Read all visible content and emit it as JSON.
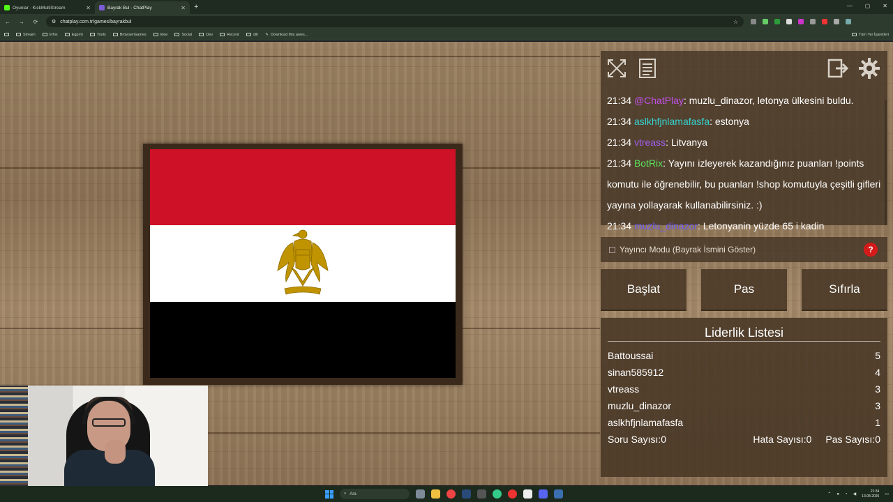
{
  "browser": {
    "tabs": [
      {
        "label": "Oyunlar - KickMultiStream",
        "active": false
      },
      {
        "label": "Bayrak Bul - ChatPlay",
        "active": true
      }
    ],
    "url": "chatplay.com.tr/games/bayrakbul",
    "bookmarks": [
      "Stream",
      "Infox",
      "Egprnt",
      "Tools",
      "BrowserGames",
      "Idee",
      "Social",
      "Dev",
      "Recent",
      "oth",
      "Download this awes..."
    ],
    "bookmarks_right": "Tüm Yer İşaretleri",
    "window_controls": [
      "—",
      "▢",
      "✕"
    ]
  },
  "game": {
    "flag_colors": [
      "#ce1126",
      "#ffffff",
      "#000000"
    ],
    "flag_emblem": "eagle-of-saladin-icon",
    "panel_icons": [
      "fullscreen-icon",
      "list-icon",
      "exit-icon",
      "gear-icon"
    ],
    "chat": [
      {
        "time": "21:34",
        "user": "@ChatPlay",
        "user_color": "#c050e8",
        "text": ": muzlu_dinazor, letonya ülkesini buldu."
      },
      {
        "time": "21:34",
        "user": "aslkhfjnlamafasfa",
        "user_color": "#36d3d0",
        "text": ": estonya"
      },
      {
        "time": "21:34",
        "user": "vtreass",
        "user_color": "#a05cf0",
        "text": ": Litvanya"
      },
      {
        "time": "21:34",
        "user": "BotRix",
        "user_color": "#5be35b",
        "text": ": Yayını izleyerek kazandığınız puanları !points komutu ile öğrenebilir, bu puanları !shop komutuyla çeşitli gifleri yayına yollayarak kullanabilirsiniz. :)"
      },
      {
        "time": "21:34",
        "user": "muzlu_dinazor",
        "user_color": "#6a5cf0",
        "text": ": Letonyanin yüzde 65 i kadin"
      }
    ],
    "streamer_mode_label": "Yayıncı Modu (Bayrak İsmini Göster)",
    "help_label": "?",
    "buttons": {
      "start": "Başlat",
      "pass": "Pas",
      "reset": "Sıfırla"
    },
    "leaderboard": {
      "title": "Liderlik Listesi",
      "rows": [
        {
          "name": "Battoussai",
          "score": "5"
        },
        {
          "name": "sinan585912",
          "score": "4"
        },
        {
          "name": "vtreass",
          "score": "3"
        },
        {
          "name": "muzlu_dinazor",
          "score": "3"
        },
        {
          "name": "aslkhfjnlamafasfa",
          "score": "1"
        }
      ],
      "question_count": "Soru Sayısı:0",
      "error_count": "Hata Sayısı:0",
      "pass_count": "Pas Sayısı:0"
    }
  },
  "taskbar": {
    "search_placeholder": "Ara",
    "time": "21:34",
    "date": "13.08.2026"
  }
}
